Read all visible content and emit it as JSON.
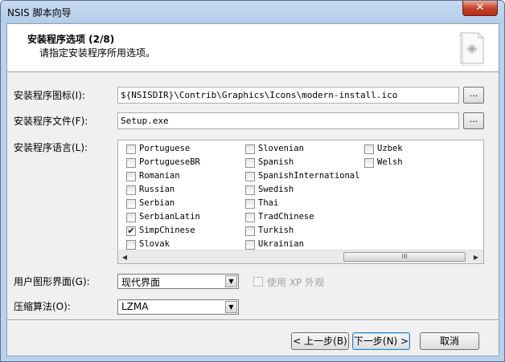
{
  "window": {
    "title": "NSIS 脚本向导",
    "close_glyph": "✕"
  },
  "header": {
    "title": "安装程序选项 (2/8)",
    "subtitle": "请指定安装程序所用选项。",
    "icon": "installer-doc-icon"
  },
  "form": {
    "icon_label": "安装程序图标(I):",
    "icon_value": "${NSISDIR}\\Contrib\\Graphics\\Icons\\modern-install.ico",
    "file_label": "安装程序文件(F):",
    "file_value": "Setup.exe",
    "browse_label": "...",
    "lang_label": "安装程序语言(L):",
    "languages": [
      [
        "Portuguese",
        "Slovenian",
        "Uzbek"
      ],
      [
        "PortugueseBR",
        "Spanish",
        "Welsh"
      ],
      [
        "Romanian",
        "SpanishInternational",
        ""
      ],
      [
        "Russian",
        "Swedish",
        ""
      ],
      [
        "Serbian",
        "Thai",
        ""
      ],
      [
        "SerbianLatin",
        "TradChinese",
        ""
      ],
      [
        "SimpChinese",
        "Turkish",
        ""
      ],
      [
        "Slovak",
        "Ukrainian",
        ""
      ]
    ],
    "checked_language": "SimpChinese",
    "scroll_left": "◀",
    "scroll_right": "▶",
    "scroll_grip": "III",
    "ui_label": "用户图形界面(G):",
    "ui_value": "现代界面",
    "xp_label": "使用 XP 外观",
    "compress_label": "压缩算法(O):",
    "compress_value": "LZMA",
    "dropdown_glyph": "▼"
  },
  "buttons": {
    "back": "< 上一步(B)",
    "next": "下一步(N) >",
    "cancel": "取消"
  }
}
